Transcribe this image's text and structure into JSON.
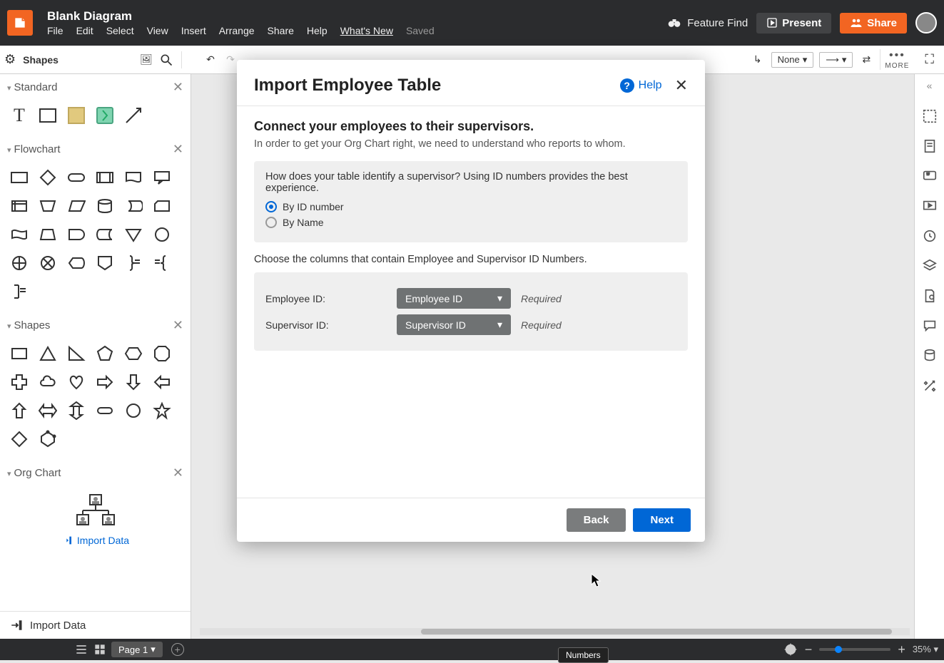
{
  "header": {
    "doc_title": "Blank Diagram",
    "menu": [
      "File",
      "Edit",
      "Select",
      "View",
      "Insert",
      "Arrange",
      "Share",
      "Help"
    ],
    "whats_new": "What's New",
    "saved": "Saved",
    "feature_find": "Feature Find",
    "present": "Present",
    "share": "Share"
  },
  "toolbar": {
    "shapes": "Shapes",
    "line_style": "None",
    "more": "MORE"
  },
  "left_panel": {
    "standard": "Standard",
    "flowchart": "Flowchart",
    "shapes": "Shapes",
    "org_chart": "Org Chart",
    "import_link": "Import Data",
    "import_footer": "Import Data"
  },
  "right_rail": {},
  "bottom": {
    "page_tab": "Page 1",
    "zoom": "35%",
    "tip": "Numbers"
  },
  "modal": {
    "title": "Import Employee Table",
    "help": "Help",
    "heading": "Connect your employees to their supervisors.",
    "sub": "In order to get your Org Chart right, we need to understand who reports to whom.",
    "question": "How does your table identify a supervisor? Using ID numbers provides the best experience.",
    "radio_id": "By ID number",
    "radio_name": "By Name",
    "choose": "Choose the columns that contain Employee and Supervisor ID Numbers.",
    "emp_label": "Employee ID:",
    "emp_value": "Employee ID",
    "sup_label": "Supervisor ID:",
    "sup_value": "Supervisor ID",
    "required": "Required",
    "back": "Back",
    "next": "Next"
  }
}
